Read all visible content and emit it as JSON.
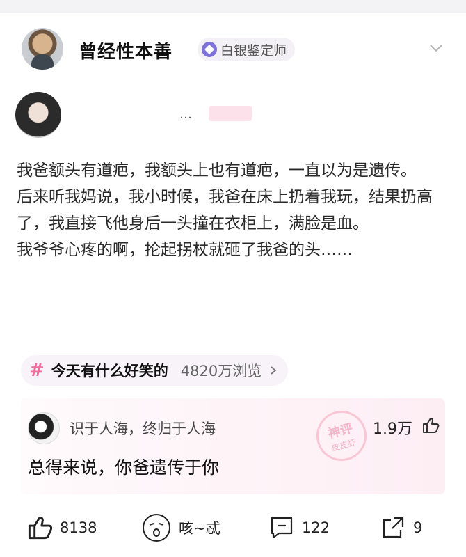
{
  "header": {
    "username": "曾经性本善",
    "badge": "白银鉴定师"
  },
  "post": {
    "dots": "…",
    "lines": [
      "我爸额头有道疤，我额头上也有道疤，一直以为是遗传。",
      "后来听我妈说，我小时候，我爸在床上扔着我玩，结果扔高了，我直接飞他身后一头撞在衣柜上，满脸是血。",
      "我爷爷心疼的啊，抡起拐杖就砸了我爸的头……"
    ]
  },
  "topic": {
    "hash": "#",
    "name": "今天有什么好笑的",
    "views": "4820万浏览"
  },
  "god_comment": {
    "user": "识于人海，终归于人海",
    "likes": "1.9万",
    "text": "总得来说，你爸遗传于你",
    "stamp_main": "神评",
    "stamp_sub": "皮皮虾"
  },
  "actions": {
    "like_count": "8138",
    "emoji_label": "咳~忒",
    "comment_count": "122",
    "share_count": "9"
  },
  "colors": {
    "accent": "#f06d9c",
    "badge": "#7e72d9"
  }
}
